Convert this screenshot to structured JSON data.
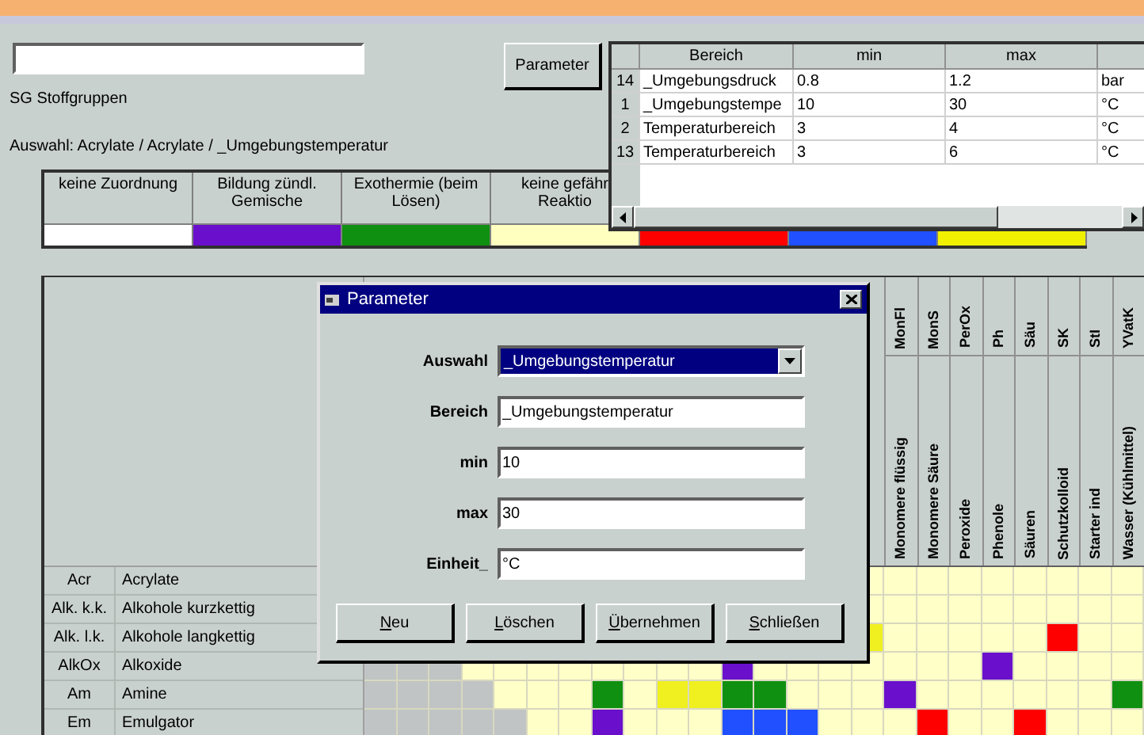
{
  "group_label": "SG Stoffgruppen",
  "parameter_button": "Parameter",
  "selection_text": "Auswahl: Acrylate / Acrylate / _Umgebungstemperatur",
  "legend": [
    {
      "lines": [
        "keine Zuordnung"
      ],
      "color": "#ffffff"
    },
    {
      "lines": [
        "Bildung zündl.",
        "Gemische"
      ],
      "color": "#6a10cc"
    },
    {
      "lines": [
        "Exothermie (beim",
        "Lösen)"
      ],
      "color": "#109010"
    },
    {
      "lines": [
        "keine gefähr",
        "Reaktio"
      ],
      "color": "#ffffc0"
    },
    {
      "color": "#ff0000"
    },
    {
      "color": "#2050ff"
    },
    {
      "color": "#f0f000"
    }
  ],
  "range_table": {
    "columns": [
      "Bereich",
      "min",
      "max"
    ],
    "rows": [
      {
        "number": "14",
        "cells": [
          "_Umgebungsdruck",
          "0.8",
          "1.2",
          "bar"
        ]
      },
      {
        "number": "1",
        "cells": [
          "_Umgebungstempe",
          "10",
          "30",
          "°C"
        ]
      },
      {
        "number": "2",
        "cells": [
          "Temperaturbereich",
          "3",
          "4",
          "°C"
        ]
      },
      {
        "number": "13",
        "cells": [
          "Temperaturbereich",
          "3",
          "6",
          "°C"
        ]
      }
    ]
  },
  "grid": {
    "columns": [
      {
        "abbr": "MonFl",
        "name": "Monomere flüssig"
      },
      {
        "abbr": "MonS",
        "name": "Monomere Säure"
      },
      {
        "abbr": "PerOx",
        "name": "Peroxide"
      },
      {
        "abbr": "Ph",
        "name": "Phenole"
      },
      {
        "abbr": "Säu",
        "name": "Säuren"
      },
      {
        "abbr": "SK",
        "name": "Schutzkolloid"
      },
      {
        "abbr": "StI",
        "name": "Starter ind"
      },
      {
        "abbr": "YVatK",
        "name": "Wasser (Kühlmittel)"
      }
    ],
    "rows": [
      {
        "abbr": "Acr",
        "name": "Acrylate",
        "cells": [
          null,
          null,
          null,
          null,
          null,
          null,
          null,
          null,
          null,
          null,
          null,
          null,
          null,
          null,
          null,
          {
            "color": "#ffffc8"
          },
          {
            "color": "#ffffc8"
          },
          {
            "color": "#ffffc8"
          },
          {
            "color": "#ffffc8"
          },
          {
            "color": "#ffffc8"
          },
          {
            "color": "#ffffc8"
          },
          {
            "color": "#ffffc8"
          },
          {
            "color": "#ffffc8"
          },
          {
            "color": "#ffffc8"
          }
        ]
      },
      {
        "abbr": "Alk. k.k.",
        "name": "Alkohole kurzkettig",
        "cells": [
          null,
          null,
          null,
          null,
          null,
          null,
          null,
          null,
          null,
          null,
          null,
          null,
          null,
          null,
          null,
          {
            "color": "#ffffc8"
          },
          {
            "color": "#ffffc8"
          },
          {
            "color": "#ffffc8"
          },
          {
            "color": "#ffffc8"
          },
          {
            "color": "#ffffc8"
          },
          {
            "color": "#ffffc8"
          },
          {
            "color": "#ffffc8"
          },
          {
            "color": "#ffffc8"
          },
          {
            "color": "#ffffc8"
          }
        ]
      },
      {
        "abbr": "Alk. l.k.",
        "name": "Alkohole langkettig",
        "cells": [
          null,
          null,
          null,
          null,
          null,
          null,
          null,
          null,
          null,
          null,
          null,
          null,
          null,
          null,
          null,
          {
            "color": "#f0f020"
          },
          {
            "color": "#ffffc8"
          },
          {
            "color": "#ffffc8"
          },
          {
            "color": "#ffffc8"
          },
          {
            "color": "#ffffc8"
          },
          {
            "color": "#ffffc8"
          },
          {
            "color": "#ff0000"
          },
          {
            "color": "#ffffc8"
          },
          {
            "color": "#ffffc8"
          }
        ]
      },
      {
        "abbr": "AlkOx",
        "name": "Alkoxide",
        "cells": [
          {
            "color": "#c0c4c4"
          },
          {
            "color": "#c0c4c4"
          },
          {
            "color": "#c0c4c4"
          },
          {
            "color": "#ffffc8"
          },
          {
            "color": "#ffffc8"
          },
          {
            "color": "#ffffc8"
          },
          {
            "color": "#ffffc8"
          },
          {
            "color": "#ffffc8"
          },
          {
            "color": "#ffffc8"
          },
          {
            "color": "#ffffc8"
          },
          {
            "color": "#ffffc8"
          },
          {
            "color": "#6a10cc"
          },
          {
            "color": "#ffffc8"
          },
          {
            "color": "#ffffc8"
          },
          {
            "color": "#ffffc8"
          },
          {
            "color": "#ffffc8"
          },
          {
            "color": "#ffffc8"
          },
          {
            "color": "#ffffc8"
          },
          {
            "color": "#ffffc8"
          },
          {
            "color": "#6a10cc"
          },
          {
            "color": "#ffffc8"
          },
          {
            "color": "#ffffc8"
          },
          {
            "color": "#ffffc8"
          },
          {
            "color": "#ffffc8"
          }
        ]
      },
      {
        "abbr": "Am",
        "name": "Amine",
        "cells": [
          {
            "color": "#c0c4c4"
          },
          {
            "color": "#c0c4c4"
          },
          {
            "color": "#c0c4c4"
          },
          {
            "color": "#c0c4c4"
          },
          {
            "color": "#ffffc8"
          },
          {
            "color": "#ffffc8"
          },
          {
            "color": "#ffffc8"
          },
          {
            "color": "#109010"
          },
          {
            "color": "#ffffc8"
          },
          {
            "color": "#f0f020"
          },
          {
            "color": "#f0f020"
          },
          {
            "color": "#109010"
          },
          {
            "color": "#109010"
          },
          {
            "color": "#ffffc8"
          },
          {
            "color": "#ffffc8"
          },
          {
            "color": "#ffffc8"
          },
          {
            "color": "#6a10cc"
          },
          {
            "color": "#ffffc8"
          },
          {
            "color": "#ffffc8"
          },
          {
            "color": "#ffffc8"
          },
          {
            "color": "#ffffc8"
          },
          {
            "color": "#ffffc8"
          },
          {
            "color": "#ffffc8"
          },
          {
            "color": "#109010"
          }
        ]
      },
      {
        "abbr": "Em",
        "name": "Emulgator",
        "cells": [
          {
            "color": "#c0c4c4"
          },
          {
            "color": "#c0c4c4"
          },
          {
            "color": "#c0c4c4"
          },
          {
            "color": "#c0c4c4"
          },
          {
            "color": "#c0c4c4"
          },
          {
            "color": "#ffffc8"
          },
          {
            "color": "#ffffc8"
          },
          {
            "color": "#6a10cc"
          },
          {
            "color": "#ffffc8"
          },
          {
            "color": "#ffffc8"
          },
          {
            "color": "#ffffc8"
          },
          {
            "color": "#2050ff"
          },
          {
            "color": "#2050ff"
          },
          {
            "color": "#2050ff"
          },
          {
            "color": "#ffffc8"
          },
          {
            "color": "#ffffc8"
          },
          {
            "color": "#ffffc8"
          },
          {
            "color": "#ff0000"
          },
          {
            "color": "#ffffc8"
          },
          {
            "color": "#ffffc8"
          },
          {
            "color": "#ff0000"
          },
          {
            "color": "#ffffc8"
          },
          {
            "color": "#ffffc8"
          },
          {
            "color": "#ffffc8"
          }
        ]
      }
    ]
  },
  "dialog": {
    "title": "Parameter",
    "fields": [
      {
        "kind": "combo",
        "label": "Auswahl",
        "value": "_Umgebungstemperatur"
      },
      {
        "kind": "text",
        "label": "Bereich",
        "value": "_Umgebungstemperatur"
      },
      {
        "kind": "text",
        "label": "min",
        "value": "10"
      },
      {
        "kind": "text",
        "label": "max",
        "value": "30"
      },
      {
        "kind": "text",
        "label": "Einheit_",
        "value": "°C"
      }
    ],
    "buttons": [
      "Neu",
      "Löschen",
      "Übernehmen",
      "Schließen"
    ]
  }
}
